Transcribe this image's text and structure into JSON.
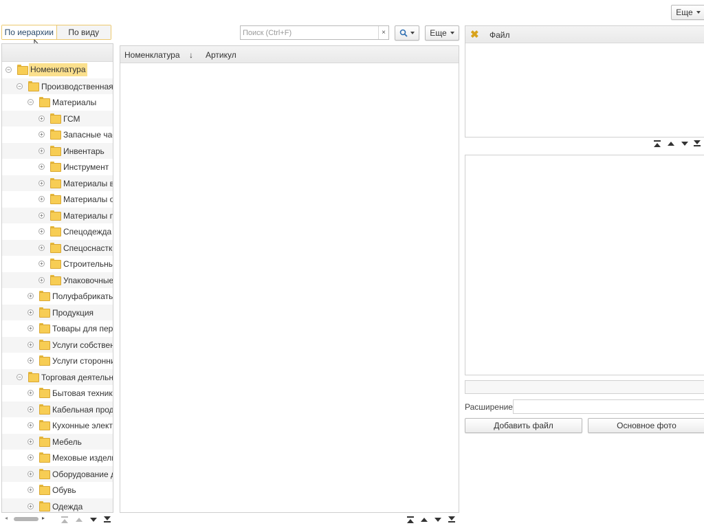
{
  "top": {
    "more_label": "Еще"
  },
  "view_toggle": {
    "hierarchy_label": "По иерархии",
    "by_type_label": "По виду"
  },
  "search": {
    "placeholder": "Поиск (Ctrl+F)",
    "clear_symbol": "×",
    "more_label": "Еще"
  },
  "tree": {
    "items": [
      {
        "label": "Номенклатура",
        "level": 0,
        "expanded": true,
        "selected": true
      },
      {
        "label": "Производственная деятельность",
        "level": 1,
        "expanded": true
      },
      {
        "label": "Материалы",
        "level": 2,
        "expanded": true
      },
      {
        "label": "ГСМ",
        "level": 3,
        "expanded": false
      },
      {
        "label": "Запасные части",
        "level": 3,
        "expanded": false
      },
      {
        "label": "Инвентарь",
        "level": 3,
        "expanded": false
      },
      {
        "label": "Инструмент",
        "level": 3,
        "expanded": false
      },
      {
        "label": "Материалы вспомогательные",
        "level": 3,
        "expanded": false
      },
      {
        "label": "Материалы основные",
        "level": 3,
        "expanded": false
      },
      {
        "label": "Материалы прочие",
        "level": 3,
        "expanded": false
      },
      {
        "label": "Спецодежда",
        "level": 3,
        "expanded": false
      },
      {
        "label": "Спецоснастка",
        "level": 3,
        "expanded": false
      },
      {
        "label": "Строительные материалы",
        "level": 3,
        "expanded": false
      },
      {
        "label": "Упаковочные материалы",
        "level": 3,
        "expanded": false
      },
      {
        "label": "Полуфабрикаты",
        "level": 2,
        "expanded": false
      },
      {
        "label": "Продукция",
        "level": 2,
        "expanded": false
      },
      {
        "label": "Товары для перепродажи",
        "level": 2,
        "expanded": false
      },
      {
        "label": "Услуги собственные",
        "level": 2,
        "expanded": false
      },
      {
        "label": "Услуги сторонних организаций",
        "level": 2,
        "expanded": false
      },
      {
        "label": "Торговая деятельность",
        "level": 1,
        "expanded": true
      },
      {
        "label": "Бытовая техника",
        "level": 2,
        "expanded": false
      },
      {
        "label": "Кабельная продукция",
        "level": 2,
        "expanded": false
      },
      {
        "label": "Кухонные электроприборы",
        "level": 2,
        "expanded": false
      },
      {
        "label": "Мебель",
        "level": 2,
        "expanded": false
      },
      {
        "label": "Меховые изделия",
        "level": 2,
        "expanded": false
      },
      {
        "label": "Оборудование для дома",
        "level": 2,
        "expanded": false
      },
      {
        "label": "Обувь",
        "level": 2,
        "expanded": false
      },
      {
        "label": "Одежда",
        "level": 2,
        "expanded": false
      }
    ]
  },
  "list": {
    "columns": [
      "Номенклатура",
      "↓",
      "Артикул"
    ]
  },
  "files": {
    "column_label": "Файл",
    "extension_label": "Расширение:",
    "add_file_label": "Добавить файл",
    "main_photo_label": "Основное фото"
  }
}
